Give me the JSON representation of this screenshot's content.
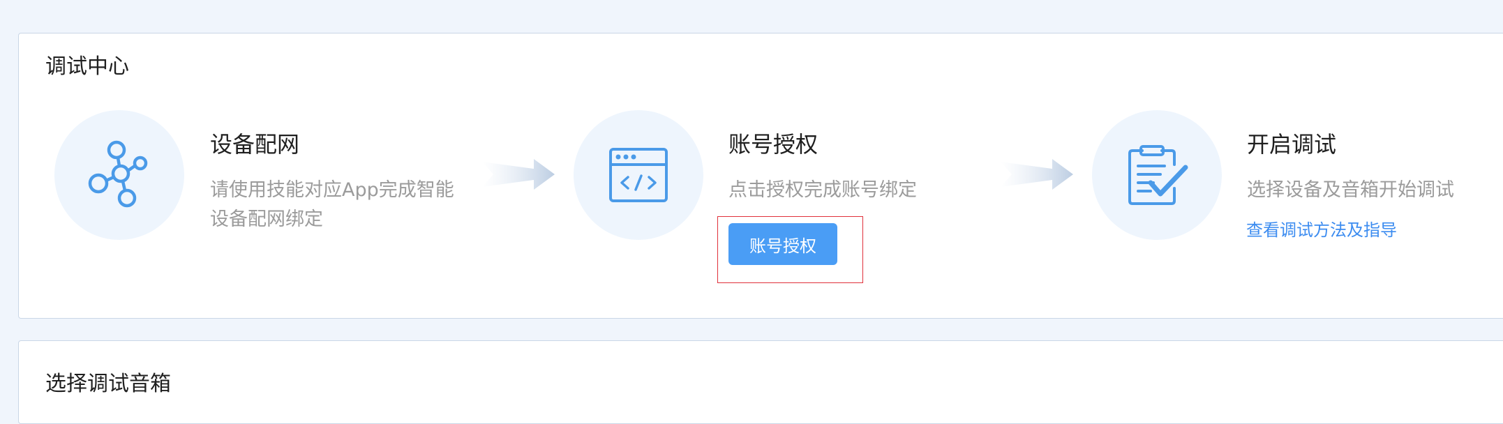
{
  "debug_center": {
    "title": "调试中心",
    "steps": [
      {
        "icon": "network-icon",
        "title": "设备配网",
        "desc_line1": "请使用技能对应App完成智能",
        "desc_line2": "设备配网绑定"
      },
      {
        "icon": "code-window-icon",
        "title": "账号授权",
        "desc_line1": "点击授权完成账号绑定",
        "button_label": "账号授权"
      },
      {
        "icon": "clipboard-check-icon",
        "title": "开启调试",
        "desc_line1": "选择设备及音箱开始调试",
        "link_label": "查看调试方法及指导"
      }
    ]
  },
  "speaker_section": {
    "title": "选择调试音箱"
  },
  "colors": {
    "accent": "#4a9df5",
    "link": "#3c8cf0",
    "highlight": "#e0303a",
    "icon": "#4a9ae8",
    "circle_bg": "#eef5fd"
  }
}
